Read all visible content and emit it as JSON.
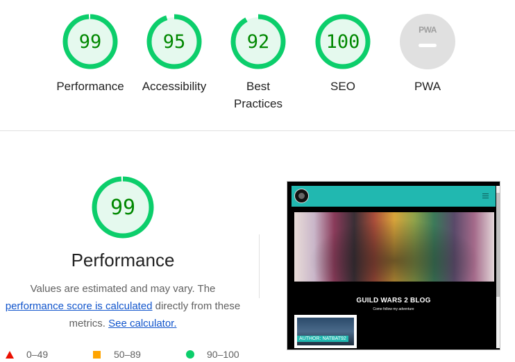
{
  "categories": [
    {
      "label": "Performance",
      "score": "99",
      "value": 99
    },
    {
      "label": "Accessibility",
      "score": "95",
      "value": 95
    },
    {
      "label": "Best Practices",
      "score": "92",
      "value": 92
    },
    {
      "label": "SEO",
      "score": "100",
      "value": 100
    }
  ],
  "pwa": {
    "badge": "PWA",
    "label": "PWA"
  },
  "performance": {
    "score": "99",
    "value": 99,
    "title": "Performance",
    "desc_line1": "Values are estimated and may vary. The",
    "desc_link1": "performance score is calculated",
    "desc_mid": " directly from these metrics. ",
    "desc_link2": "See calculator."
  },
  "legend": {
    "fail": "0–49",
    "average": "50–89",
    "pass": "90–100"
  },
  "thumbnail": {
    "site_title": "GUILD WARS 2 BLOG",
    "site_subtitle": "Come follow my adventure",
    "card_label": "AUTHOR: NATBAT92"
  },
  "colors": {
    "pass": "#0cce6b",
    "pass_fill": "#e5f9ee",
    "pass_text": "#008800",
    "average": "#ffa400",
    "fail": "#eb0f00",
    "pwa_gray": "#e0e0e0",
    "accent_teal": "#21b8b0",
    "link": "#1155cc"
  }
}
